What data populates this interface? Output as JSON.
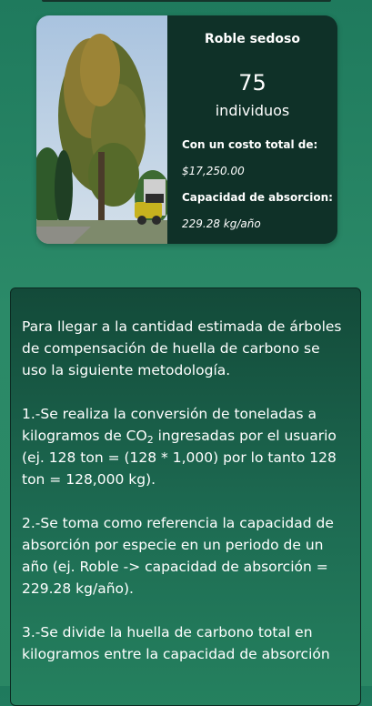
{
  "card": {
    "species": "Roble sedoso",
    "count": "75",
    "count_unit": "individuos",
    "cost_label": "Con un costo total de:",
    "cost_value": "$17,250.00",
    "absorption_label": "Capacidad de absorcion:",
    "absorption_value": "229.28 kg/año"
  },
  "methodology": {
    "intro": "Para llegar a la cantidad estimada de árboles de compensación de huella de carbono se uso la siguiente metodología.",
    "step1_a": "1.-Se realiza la conversión de toneladas a kilogramos de CO",
    "step1_sub": "2",
    "step1_b": " ingresadas por el usuario (ej. 128 ton = (128 * 1,000) por lo tanto 128 ton = 128,000 kg).",
    "step2": "2.-Se toma como referencia la capacidad de absorción por especie en un periodo de un año (ej. Roble -> capacidad de absorción = 229.28 kg/año).",
    "step3": "3.-Se divide la huella de carbono total en kilogramos entre la capacidad de absorción"
  }
}
